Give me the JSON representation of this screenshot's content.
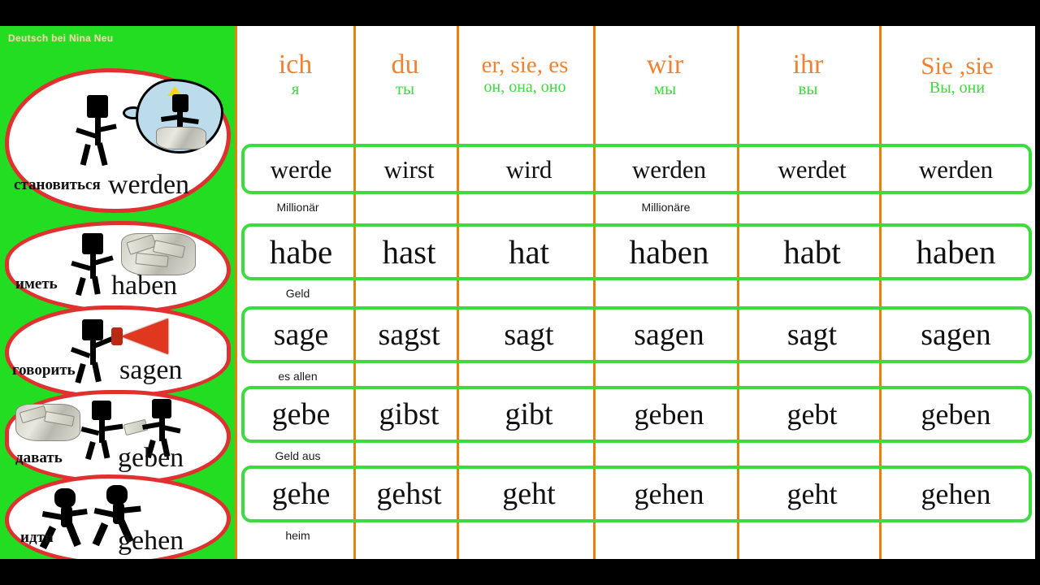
{
  "watermark": "Deutsch bei Nina Neu",
  "colors": {
    "sidebar_bg": "#22dd22",
    "card_outline": "#e03030",
    "card_fill": "#ffffff",
    "pronoun_de": "#ef8234",
    "pronoun_ru": "#3ddb3d",
    "row_border": "#3ddb3d",
    "column_divider": "#e8820c",
    "frame": "#000000"
  },
  "header": {
    "columns": [
      {
        "de": "ich",
        "ru": "я"
      },
      {
        "de": "du",
        "ru": "ты"
      },
      {
        "de": "er, sie, es",
        "ru": "он, она, оно"
      },
      {
        "de": "wir",
        "ru": "мы"
      },
      {
        "de": "ihr",
        "ru": "вы"
      },
      {
        "de": "Sie ,sie",
        "ru": "Вы, они"
      }
    ]
  },
  "verbs": [
    {
      "infinitive": "werden",
      "russian": "становиться",
      "icon": "stick-figure-thought-millionaire-icon",
      "forms": [
        "werde",
        "wirst",
        "wird",
        "werden",
        "werdet",
        "werden"
      ],
      "notes": [
        "Millionär",
        "",
        "",
        "Millionäre",
        "",
        ""
      ]
    },
    {
      "infinitive": "haben",
      "russian": "иметь",
      "icon": "stick-figure-money-icon",
      "forms": [
        "habe",
        "hast",
        "hat",
        "haben",
        "habt",
        "haben"
      ],
      "notes": [
        "Geld",
        "",
        "",
        "",
        "",
        ""
      ]
    },
    {
      "infinitive": "sagen",
      "russian": "говорить",
      "icon": "stick-figure-megaphone-icon",
      "forms": [
        "sage",
        "sagst",
        "sagt",
        "sagen",
        "sagt",
        "sagen"
      ],
      "notes": [
        "es allen",
        "",
        "",
        "",
        "",
        ""
      ]
    },
    {
      "infinitive": "geben",
      "russian": "давать",
      "icon": "two-stick-figures-money-exchange-icon",
      "forms": [
        "gebe",
        "gibst",
        "gibt",
        "geben",
        "gebt",
        "geben"
      ],
      "notes": [
        "Geld aus",
        "",
        "",
        "",
        "",
        ""
      ]
    },
    {
      "infinitive": "gehen",
      "russian": "идти",
      "icon": "two-stick-figures-walking-icon",
      "forms": [
        "gehe",
        "gehst",
        "geht",
        "gehen",
        "geht",
        "gehen"
      ],
      "notes": [
        "heim",
        "",
        "",
        "",
        "",
        ""
      ]
    }
  ]
}
